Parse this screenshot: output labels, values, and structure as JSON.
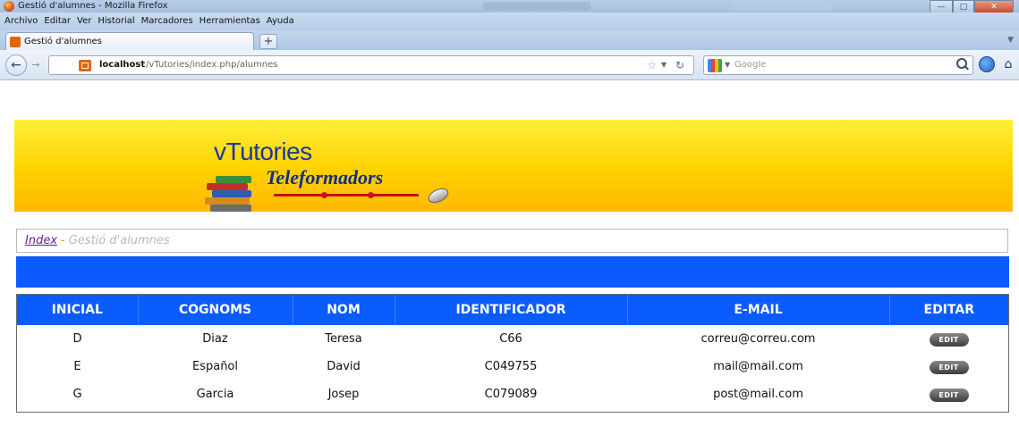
{
  "window": {
    "title": "Gestió d'alumnes - Mozilla Firefox"
  },
  "menubar": {
    "items": [
      "Archivo",
      "Editar",
      "Ver",
      "Historial",
      "Marcadores",
      "Herramientas",
      "Ayuda"
    ]
  },
  "tabs": [
    {
      "label": "Gestió d'alumnes"
    }
  ],
  "navbar": {
    "url_host": "localhost",
    "url_path": "/vTutories/index.php/alumnes",
    "search_placeholder": "Google"
  },
  "banner": {
    "title": "vTutories",
    "subtitle": "Teleformadors"
  },
  "breadcrumb": {
    "index_label": "Index",
    "separator": "-",
    "current": "Gestió d'alumnes"
  },
  "table": {
    "headers": [
      "INICIAL",
      "COGNOMS",
      "NOM",
      "IDENTIFICADOR",
      "E-MAIL",
      "EDITAR"
    ],
    "rows": [
      {
        "inicial": "D",
        "cognoms": "Diaz",
        "nom": "Teresa",
        "identificador": "C66",
        "email": "correu@correu.com",
        "edit_label": "EDIT"
      },
      {
        "inicial": "E",
        "cognoms": "Español",
        "nom": "David",
        "identificador": "C049755",
        "email": "mail@mail.com",
        "edit_label": "EDIT"
      },
      {
        "inicial": "G",
        "cognoms": "Garcia",
        "nom": "Josep",
        "identificador": "C079089",
        "email": "post@mail.com",
        "edit_label": "EDIT"
      }
    ]
  },
  "colors": {
    "header_blue": "#0b5cff",
    "banner_yellow": "#ffd100",
    "logo_blue": "#173a96",
    "logo_red": "#c90f1b"
  }
}
